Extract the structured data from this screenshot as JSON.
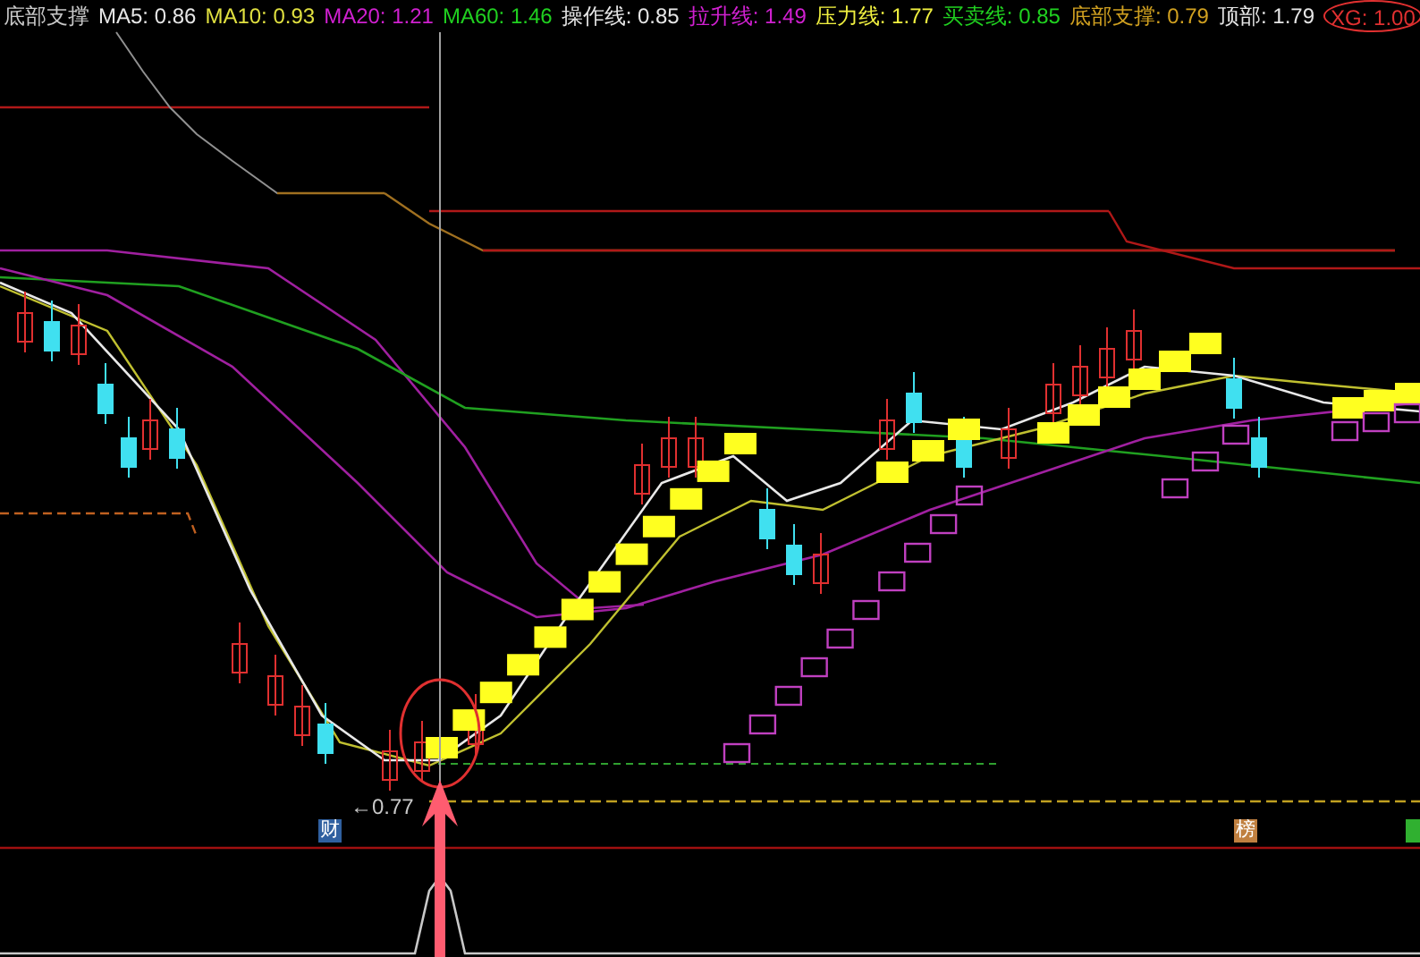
{
  "legend": [
    {
      "name": "底部支撑",
      "color": "#c8c8c8"
    },
    {
      "name": "MA5:",
      "value": "0.86",
      "color": "#e6e6e6"
    },
    {
      "name": "MA10:",
      "value": "0.93",
      "color": "#e0e040"
    },
    {
      "name": "MA20:",
      "value": "1.21",
      "color": "#d020d0"
    },
    {
      "name": "MA60:",
      "value": "1.46",
      "color": "#20d020"
    },
    {
      "name": "操作线:",
      "value": "0.85",
      "color": "#e6e6e6"
    },
    {
      "name": "拉升线:",
      "value": "1.49",
      "color": "#d020d0"
    },
    {
      "name": "压力线:",
      "value": "1.77",
      "color": "#f0f040"
    },
    {
      "name": "买卖线:",
      "value": "0.85",
      "color": "#20d020"
    },
    {
      "name": "底部支撑:",
      "value": "0.79",
      "color": "#d0a020"
    },
    {
      "name": "顶部:",
      "value": "1.79",
      "color": "#e6e6e6"
    },
    {
      "name": "XG:",
      "value": "1.00",
      "color": "#e03030"
    }
  ],
  "chart": {
    "low_label": "←0.77",
    "markers": [
      {
        "text": "财",
        "color": "#3060a0"
      },
      {
        "text": "榜",
        "color": "#c08040"
      },
      {
        "color": "#30b030"
      }
    ]
  }
}
